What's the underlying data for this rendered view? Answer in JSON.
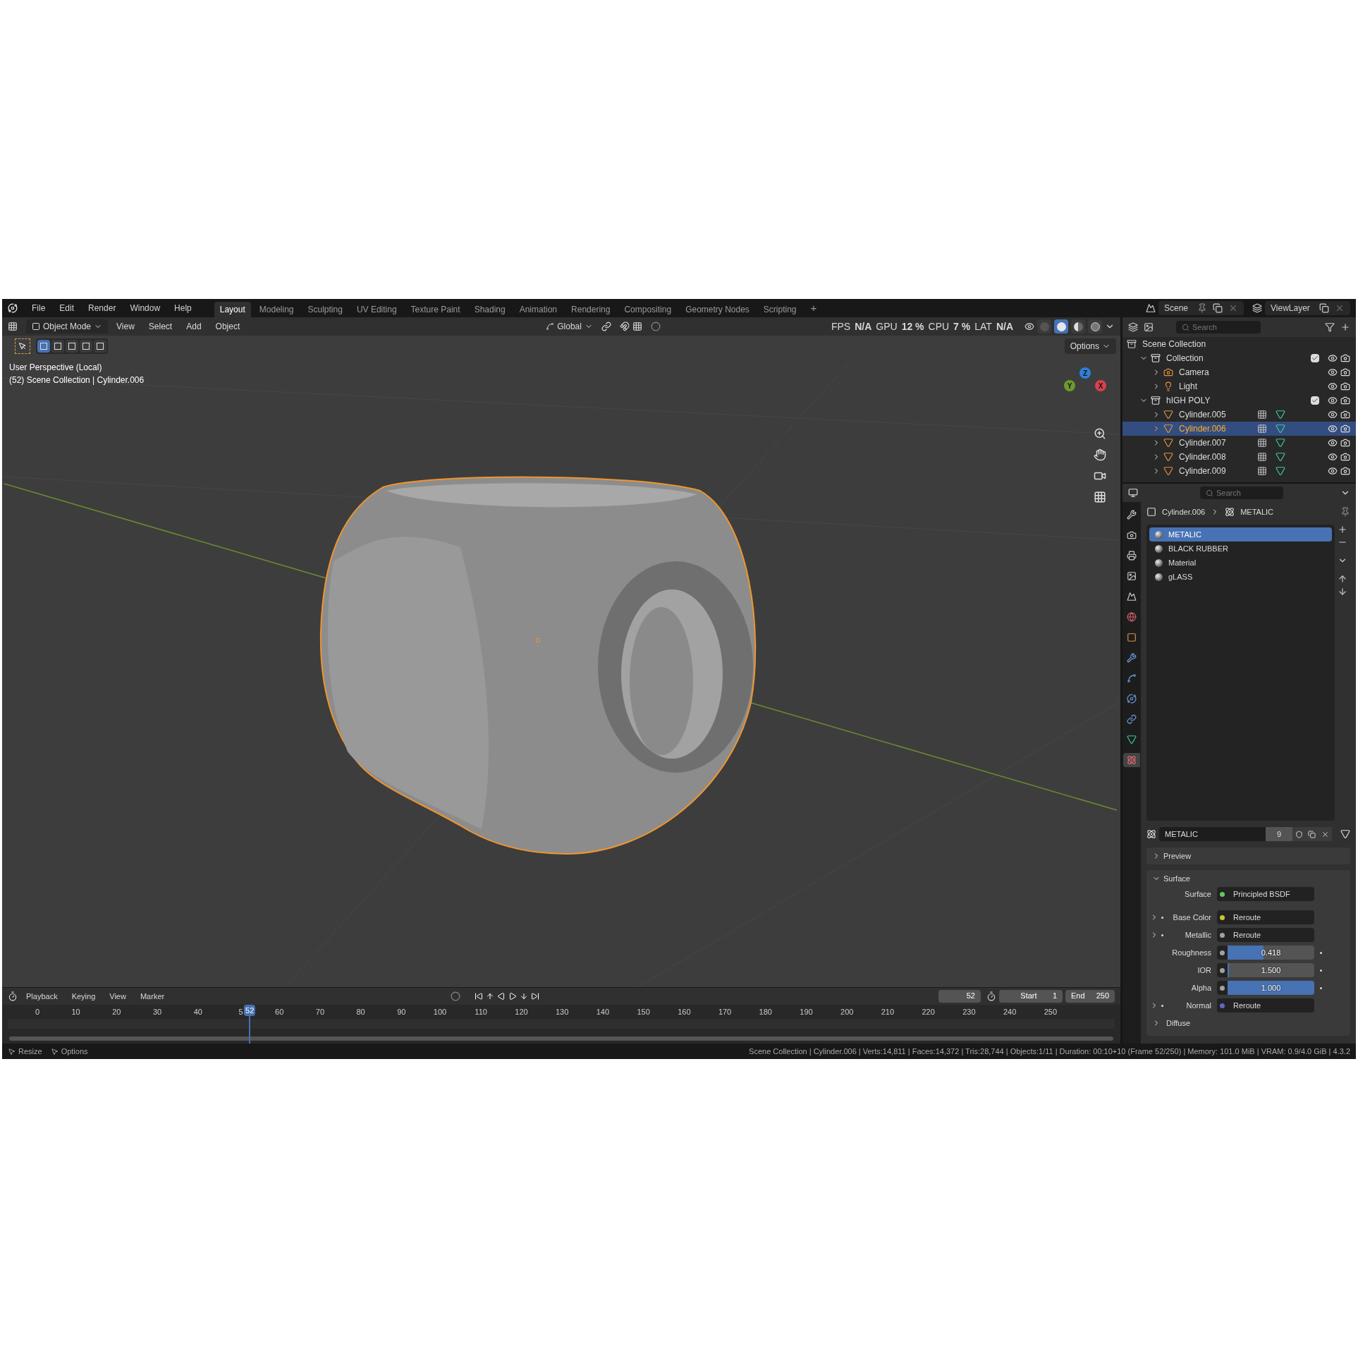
{
  "menu": [
    "File",
    "Edit",
    "Render",
    "Window",
    "Help"
  ],
  "workspaces": [
    {
      "label": "Layout",
      "selected": true
    },
    {
      "label": "Modeling",
      "selected": false
    },
    {
      "label": "Sculpting",
      "selected": false
    },
    {
      "label": "UV Editing",
      "selected": false
    },
    {
      "label": "Texture Paint",
      "selected": false
    },
    {
      "label": "Shading",
      "selected": false
    },
    {
      "label": "Animation",
      "selected": false
    },
    {
      "label": "Rendering",
      "selected": false
    },
    {
      "label": "Compositing",
      "selected": false
    },
    {
      "label": "Geometry Nodes",
      "selected": false
    },
    {
      "label": "Scripting",
      "selected": false
    }
  ],
  "add_workspace": "+",
  "scene": "Scene",
  "view_layer": "ViewLayer",
  "viewport": {
    "mode": "Object Mode",
    "menus": [
      "View",
      "Select",
      "Add",
      "Object"
    ],
    "orientation": "Global",
    "stats": [
      {
        "label": "FPS",
        "value": "N/A"
      },
      {
        "label": "GPU",
        "value": "12 %"
      },
      {
        "label": "CPU",
        "value": "7 %"
      },
      {
        "label": "LAT",
        "value": "N/A"
      }
    ],
    "shading": [
      {
        "kind": "wireframe",
        "selected": false
      },
      {
        "kind": "solid",
        "selected": true
      },
      {
        "kind": "material",
        "selected": false
      },
      {
        "kind": "rendered",
        "selected": false
      }
    ],
    "select_modes": [
      {
        "selected": true
      },
      {
        "selected": false
      },
      {
        "selected": false
      },
      {
        "selected": false
      },
      {
        "selected": false
      }
    ],
    "options": "Options",
    "info": [
      "User Perspective (Local)",
      "(52) Scene Collection | Cylinder.006"
    ],
    "gizmo": [
      "Z",
      "Y",
      "X"
    ]
  },
  "outliner": {
    "search": {
      "placeholder": "Search"
    },
    "tree": [
      {
        "label": "Scene Collection",
        "kind": "scene",
        "children": [
          {
            "label": "Collection",
            "kind": "collection",
            "expanded": true,
            "checked": true,
            "selected": false,
            "children": [
              {
                "label": "Camera",
                "kind": "camera",
                "expanded": false,
                "selected": false
              },
              {
                "label": "Light",
                "kind": "light",
                "expanded": false,
                "selected": false
              }
            ]
          },
          {
            "label": "hIGH POLY",
            "kind": "collection",
            "expanded": true,
            "checked": true,
            "selected": false,
            "children": [
              {
                "label": "Cylinder.005",
                "kind": "mesh",
                "expanded": false,
                "selected": false
              },
              {
                "label": "Cylinder.006",
                "kind": "mesh",
                "expanded": false,
                "selected": true
              },
              {
                "label": "Cylinder.007",
                "kind": "mesh",
                "expanded": false,
                "selected": false
              },
              {
                "label": "Cylinder.008",
                "kind": "mesh",
                "expanded": false,
                "selected": false
              },
              {
                "label": "Cylinder.009",
                "kind": "mesh",
                "expanded": false,
                "selected": false
              }
            ]
          }
        ]
      }
    ]
  },
  "properties": {
    "search": {
      "placeholder": "Search"
    },
    "tabs": [
      {
        "kind": "tool",
        "selected": false
      },
      {
        "kind": "render",
        "selected": false
      },
      {
        "kind": "output",
        "selected": false
      },
      {
        "kind": "view_layer",
        "selected": false
      },
      {
        "kind": "scene",
        "selected": false
      },
      {
        "kind": "world",
        "selected": false
      },
      {
        "kind": "object",
        "selected": false
      },
      {
        "kind": "modifiers",
        "selected": false
      },
      {
        "kind": "particles",
        "selected": false
      },
      {
        "kind": "physics",
        "selected": false
      },
      {
        "kind": "constraints",
        "selected": false
      },
      {
        "kind": "data",
        "selected": false
      },
      {
        "kind": "material",
        "selected": true
      }
    ],
    "breadcrumb": [
      "Cylinder.006",
      "METALIC"
    ],
    "materials": [
      {
        "label": "METALIC",
        "selected": true
      },
      {
        "label": "BLACK RUBBER",
        "selected": false
      },
      {
        "label": "Material",
        "selected": false
      },
      {
        "label": "gLASS",
        "selected": false
      }
    ],
    "slot": {
      "name": "METALIC",
      "users": "9"
    },
    "panels": [
      {
        "label": "Preview",
        "expanded": false
      },
      {
        "label": "Surface",
        "expanded": true,
        "rows": [
          {
            "kind": "link",
            "label": "Surface",
            "value": "Principled BSDF",
            "color": "#63c763",
            "expandable": false
          },
          {
            "kind": "link",
            "label": "Base Color",
            "value": "Reroute",
            "color": "#c7c729",
            "expandable": true
          },
          {
            "kind": "link",
            "label": "Metallic",
            "value": "Reroute",
            "color": "#a1a1a1",
            "expandable": true
          },
          {
            "kind": "slider",
            "label": "Roughness",
            "value": "0.418",
            "level": 0.418,
            "color": "#a1a1a1",
            "expandable": false
          },
          {
            "kind": "slider",
            "label": "IOR",
            "value": "1.500",
            "level": 0,
            "color": "#a1a1a1",
            "expandable": false
          },
          {
            "kind": "slider",
            "label": "Alpha",
            "value": "1.000",
            "level": 1,
            "color": "#a1a1a1",
            "expandable": false
          },
          {
            "kind": "link",
            "label": "Normal",
            "value": "Reroute",
            "color": "#6363c7",
            "expandable": true
          }
        ],
        "subpanels": [
          {
            "label": "Diffuse",
            "expanded": false
          }
        ]
      }
    ]
  },
  "timeline": {
    "menus": [
      "Playback",
      "Keying",
      "View",
      "Marker"
    ],
    "current_frame": "52",
    "start": {
      "label": "Start",
      "value": "1"
    },
    "end": {
      "label": "End",
      "value": "250"
    },
    "ticks": [
      "0",
      "10",
      "20",
      "30",
      "40",
      "5",
      "60",
      "70",
      "80",
      "90",
      "100",
      "110",
      "120",
      "130",
      "140",
      "150",
      "160",
      "170",
      "180",
      "190",
      "200",
      "210",
      "220",
      "230",
      "240",
      "250"
    ],
    "playhead": {
      "label": "52",
      "level": 0.208
    }
  },
  "status_bar": {
    "left": [
      "Resize",
      "Options"
    ],
    "right": "Scene Collection | Cylinder.006 | Verts:14,811 | Faces:14,372 | Tris:28,744 | Objects:1/11 | Duration: 00:10+10 (Frame 52/250) | Memory: 101.0 MiB | VRAM: 0.9/4.0 GiB | 4.3.2"
  }
}
